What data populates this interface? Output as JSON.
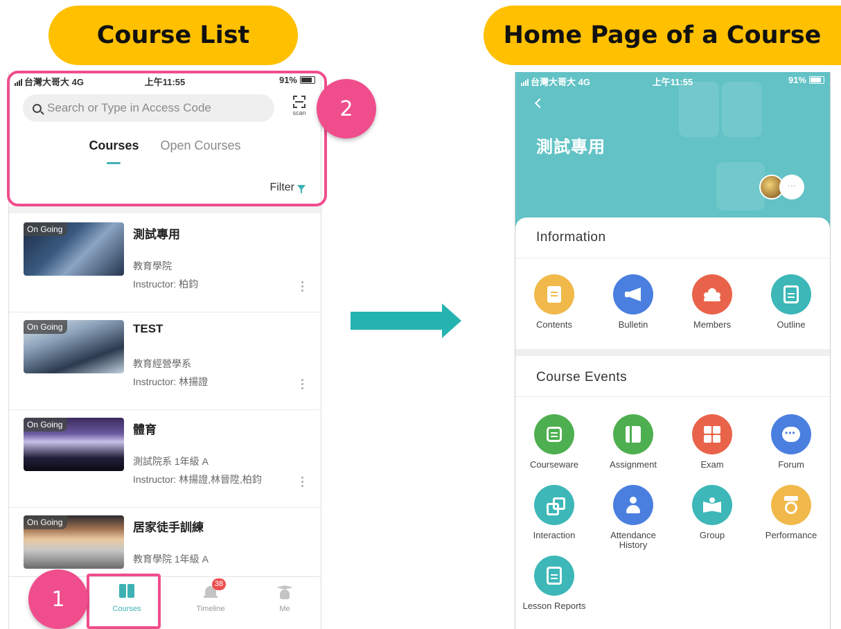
{
  "labels": {
    "left_title": "Course List",
    "right_title": "Home Page of a Course",
    "badge_1": "1",
    "badge_2": "2"
  },
  "colors": {
    "title_yellow": "#ffc000",
    "highlight_pink": "#f04d8d",
    "accent_teal": "#3fb1b5",
    "header_teal": "#62c2c6",
    "arrow_teal": "#25b3b0"
  },
  "status_bar": {
    "carrier": "台灣大哥大 4G",
    "time": "上午11:55",
    "battery": "91%"
  },
  "course_list": {
    "search_placeholder": "Search or Type in Access Code",
    "scan_label": "scan",
    "tabs": [
      {
        "label": "Courses",
        "active": true
      },
      {
        "label": "Open Courses",
        "active": false
      }
    ],
    "filter_label": "Filter",
    "courses": [
      {
        "status": "On Going",
        "title": "測試專用",
        "dept": "教育學院",
        "instructor": "Instructor: 柏鈞",
        "thumb": "chip"
      },
      {
        "status": "On Going",
        "title": "TEST",
        "dept": "教育經營學系",
        "instructor": "Instructor: 林揚證",
        "thumb": "city"
      },
      {
        "status": "On Going",
        "title": "體育",
        "dept": "測試院系 1年級 A",
        "instructor": "Instructor: 林揚證,林晉陞,柏鈞",
        "thumb": "concert"
      },
      {
        "status": "On Going",
        "title": "居家徒手訓練",
        "dept": "教育學院 1年級 A",
        "instructor": "",
        "thumb": "mount"
      }
    ],
    "bottom_nav": [
      {
        "label": "Courses",
        "icon": "book-icon",
        "active": true
      },
      {
        "label": "Timeline",
        "icon": "bell-icon",
        "badge": "38",
        "active": false
      },
      {
        "label": "Me",
        "icon": "graduate-icon",
        "active": false
      }
    ]
  },
  "course_home": {
    "course_name": "測試專用",
    "avatar_more": "···",
    "information_heading": "Information",
    "information_items": [
      {
        "label": "Contents",
        "icon": "document-icon",
        "color": "#f0b94a"
      },
      {
        "label": "Bulletin",
        "icon": "megaphone-icon",
        "color": "#4a7fe0"
      },
      {
        "label": "Members",
        "icon": "people-icon",
        "color": "#e9634a"
      },
      {
        "label": "Outline",
        "icon": "clipboard-icon",
        "color": "#3db7b8"
      }
    ],
    "events_heading": "Course Events",
    "event_items": [
      {
        "label": "Courseware",
        "icon": "courseware-icon",
        "color": "#4daf4f"
      },
      {
        "label": "Assignment",
        "icon": "assignment-icon",
        "color": "#4daf4f"
      },
      {
        "label": "Exam",
        "icon": "calculator-icon",
        "color": "#e9634a"
      },
      {
        "label": "Forum",
        "icon": "chat-bubble-icon",
        "color": "#4a7fe0"
      },
      {
        "label": "Interaction",
        "icon": "interaction-icon",
        "color": "#3db7b8"
      },
      {
        "label": "Attendance\nHistory",
        "icon": "attendance-icon",
        "color": "#4a7fe0"
      },
      {
        "label": "Group",
        "icon": "group-icon",
        "color": "#3db7b8"
      },
      {
        "label": "Performance",
        "icon": "medal-icon",
        "color": "#f0b94a"
      },
      {
        "label": "Lesson Reports",
        "icon": "report-icon",
        "color": "#3db7b8"
      }
    ]
  }
}
